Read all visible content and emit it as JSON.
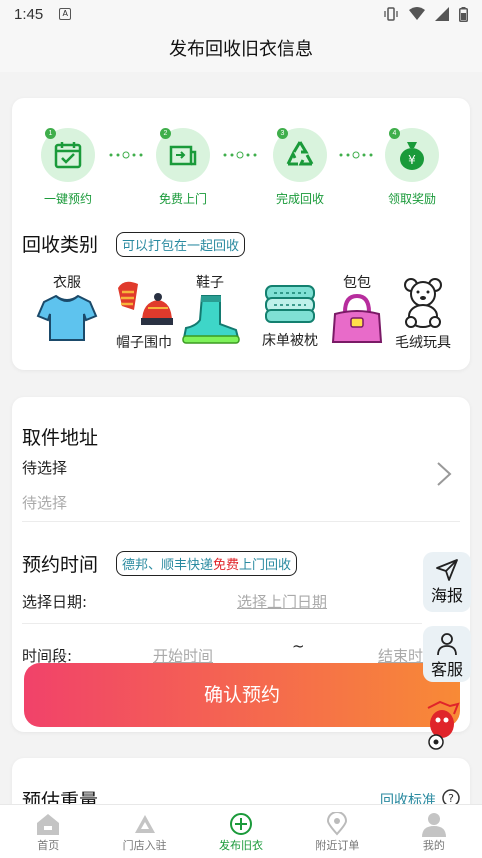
{
  "status_bar": {
    "time": "1:45",
    "notif_letter": "A"
  },
  "header": {
    "title": "发布回收旧衣信息"
  },
  "steps": [
    {
      "num": "1",
      "label": "一键预约"
    },
    {
      "num": "2",
      "label": "免费上门"
    },
    {
      "num": "3",
      "label": "完成回收"
    },
    {
      "num": "4",
      "label": "领取奖励"
    }
  ],
  "category": {
    "title": "回收类别",
    "tag": "可以打包在一起回收",
    "items": [
      {
        "label": "衣服"
      },
      {
        "label": "帽子围巾"
      },
      {
        "label": "鞋子"
      },
      {
        "label": "床单被枕"
      },
      {
        "label": "包包"
      },
      {
        "label": "毛绒玩具"
      }
    ]
  },
  "address": {
    "title": "取件地址",
    "line1": "待选择",
    "line2": "待选择"
  },
  "appointment": {
    "title": "预约时间",
    "tag_part1": "德邦、顺丰快递",
    "tag_free": "免费",
    "tag_part2": "上门回收",
    "date_label": "选择日期:",
    "date_placeholder": "选择上门日期",
    "period_label": "时间段:",
    "start_placeholder": "开始时间",
    "tilde": "~",
    "end_placeholder": "结束时间"
  },
  "confirm_button": "确认预约",
  "float_buttons": {
    "share": "海报",
    "service": "客服"
  },
  "weight": {
    "title": "预估重量",
    "standard_link": "回收标准"
  },
  "tabbar": [
    {
      "label": "首页",
      "icon": "home-icon"
    },
    {
      "label": "门店入驻",
      "icon": "store-icon"
    },
    {
      "label": "发布旧衣",
      "icon": "plus-circle-icon",
      "active": true
    },
    {
      "label": "附近订单",
      "icon": "location-icon"
    },
    {
      "label": "我的",
      "icon": "profile-icon"
    }
  ],
  "colors": {
    "accent_green": "#1a9a3a",
    "button_gradient_start": "#f1426a",
    "button_gradient_end": "#f88a36",
    "tag_text": "#2a8aa0",
    "free_red": "#e0242a"
  }
}
